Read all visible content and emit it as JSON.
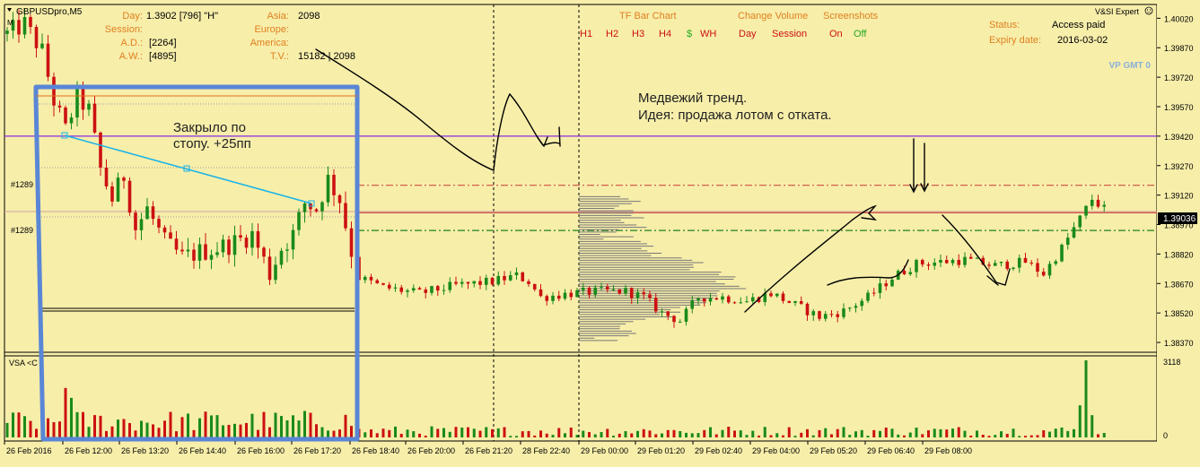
{
  "header": {
    "symbol": "GBPUSDpro,M5",
    "subtitle": "M",
    "expert_name": "V&SI Expert",
    "vp_label": "VP GMT 0",
    "smile_icon": "smiley-icon"
  },
  "info_panel": {
    "day_label": "Day:",
    "day_value": "1.3902  [796]   \"H\"",
    "session_label": "Session:",
    "ad_label": "A.D.:",
    "ad_value": "[2264]",
    "aw_label": "A.W.:",
    "aw_value": "[4895]",
    "asia_label": "Asia:",
    "asia_value": "2098",
    "europe_label": "Europe:",
    "america_label": "America:",
    "tv_label": "T.V.:",
    "tv_value": "15182 | 2098"
  },
  "tf_panel": {
    "title": "TF Bar Chart",
    "items": [
      {
        "label": "H1",
        "color": "#cc1111"
      },
      {
        "label": "H2",
        "color": "#cc1111"
      },
      {
        "label": "H3",
        "color": "#cc1111"
      },
      {
        "label": "H4",
        "color": "#cc1111"
      },
      {
        "label": "$",
        "color": "#22aa22"
      },
      {
        "label": "WH",
        "color": "#cc1111"
      }
    ]
  },
  "volume_panel": {
    "title": "Change Volume",
    "day": "Day",
    "session": "Session"
  },
  "screenshots_panel": {
    "title": "Screenshots",
    "on": "On",
    "off": "Off"
  },
  "status_panel": {
    "status_label": "Status:",
    "status_value": "Access paid",
    "expiry_label": "Expiry date:",
    "expiry_value": "2016-03-02"
  },
  "annotations": {
    "left_note_line1": "Закрыло по",
    "left_note_line2": "стопу. +25пп",
    "right_note_line1": "Медвежий тренд.",
    "right_note_line2": "Идея: продажа лотом с отката.",
    "order_label_1": "#1289",
    "order_label_2": "#1289"
  },
  "price_axis": {
    "labels": [
      "1.40020",
      "1.39870",
      "1.39720",
      "1.39570",
      "1.39420",
      "1.39270",
      "1.39120",
      "1.38970",
      "1.38820",
      "1.38670",
      "1.38520",
      "1.38370"
    ],
    "current_price": "1.39036"
  },
  "volume_indicator": {
    "label": "VSA <C",
    "max_label": "3118",
    "zero_label": "0"
  },
  "chart_data": {
    "type": "candlestick",
    "instrument": "GBPUSDpro",
    "timeframe": "M5",
    "x_ticks": [
      "26 Feb 2016",
      "26 Feb 12:00",
      "26 Feb 13:20",
      "26 Feb 14:40",
      "26 Feb 16:00",
      "26 Feb 17:20",
      "26 Feb 18:40",
      "26 Feb 20:00",
      "26 Feb 21:20",
      "28 Feb 22:40",
      "29 Feb 00:00",
      "29 Feb 01:20",
      "29 Feb 02:40",
      "29 Feb 04:00",
      "29 Feb 05:20",
      "29 Feb 06:40",
      "29 Feb 08:00"
    ],
    "ylim": [
      1.3832,
      1.4009
    ],
    "price_levels": [
      {
        "price": 1.3942,
        "color": "#8a2be2",
        "style": "solid"
      },
      {
        "price": 1.3917,
        "color": "#d05040",
        "style": "dashdot"
      },
      {
        "price": 1.3903,
        "color": "#d05040",
        "style": "solid"
      },
      {
        "price": 1.3894,
        "color": "#208020",
        "style": "dashdot"
      }
    ],
    "current_price": 1.39036,
    "close_path": [
      [
        0,
        1.3994
      ],
      [
        3,
        1.3999
      ],
      [
        6,
        1.3985
      ],
      [
        8,
        1.396
      ],
      [
        10,
        1.3945
      ],
      [
        12,
        1.3962
      ],
      [
        14,
        1.3955
      ],
      [
        16,
        1.3925
      ],
      [
        18,
        1.391
      ],
      [
        20,
        1.3922
      ],
      [
        22,
        1.3895
      ],
      [
        24,
        1.3905
      ],
      [
        27,
        1.3888
      ],
      [
        30,
        1.388
      ],
      [
        33,
        1.3883
      ],
      [
        36,
        1.3885
      ],
      [
        39,
        1.3888
      ],
      [
        42,
        1.3892
      ],
      [
        45,
        1.3872
      ],
      [
        47,
        1.3885
      ],
      [
        49,
        1.3892
      ],
      [
        51,
        1.3908
      ],
      [
        53,
        1.3905
      ],
      [
        55,
        1.392
      ],
      [
        57,
        1.391
      ],
      [
        60,
        1.387
      ],
      [
        64,
        1.3865
      ],
      [
        70,
        1.3862
      ],
      [
        76,
        1.3866
      ],
      [
        82,
        1.3868
      ],
      [
        86,
        1.3871
      ],
      [
        88,
        1.3868
      ],
      [
        90,
        1.386
      ],
      [
        95,
        1.3862
      ],
      [
        100,
        1.3863
      ],
      [
        104,
        1.3863
      ],
      [
        107,
        1.386
      ],
      [
        110,
        1.3852
      ],
      [
        113,
        1.3848
      ],
      [
        116,
        1.386
      ],
      [
        120,
        1.386
      ],
      [
        124,
        1.3858
      ],
      [
        128,
        1.3862
      ],
      [
        132,
        1.3856
      ],
      [
        136,
        1.385
      ],
      [
        140,
        1.3853
      ],
      [
        144,
        1.386
      ],
      [
        148,
        1.387
      ],
      [
        152,
        1.3877
      ],
      [
        156,
        1.3878
      ],
      [
        160,
        1.3879
      ],
      [
        165,
        1.3876
      ],
      [
        170,
        1.3878
      ],
      [
        173,
        1.3872
      ],
      [
        176,
        1.3885
      ],
      [
        179,
        1.39
      ],
      [
        181,
        1.391
      ],
      [
        183,
        1.3905
      ]
    ],
    "volume_spike_index": 180,
    "volume_max": 3118
  }
}
